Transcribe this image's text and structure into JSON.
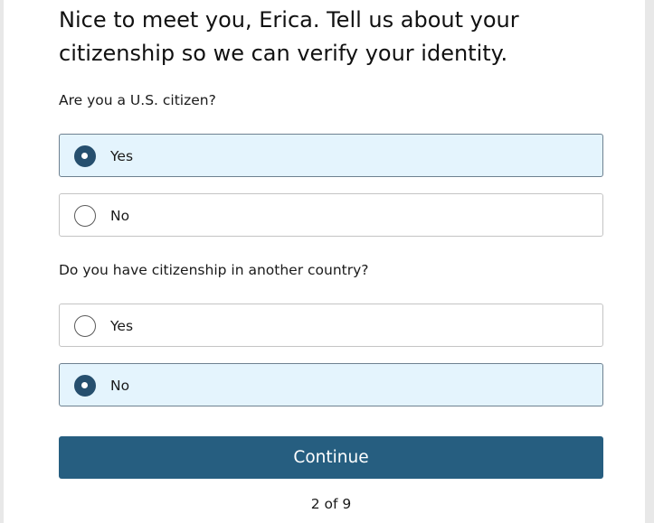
{
  "heading": "Nice to meet you, Erica. Tell us about your citizenship so we can verify your identity.",
  "questions": [
    {
      "label": "Are you a U.S. citizen?",
      "options": [
        {
          "label": "Yes",
          "selected": true
        },
        {
          "label": "No",
          "selected": false
        }
      ]
    },
    {
      "label": "Do you have citizenship in another country?",
      "options": [
        {
          "label": "Yes",
          "selected": false
        },
        {
          "label": "No",
          "selected": true
        }
      ]
    }
  ],
  "continue_label": "Continue",
  "progress": "2 of 9",
  "colors": {
    "accent": "#265e80",
    "selected_background": "#e4f4fd",
    "radio_checked": "#264f6e"
  }
}
